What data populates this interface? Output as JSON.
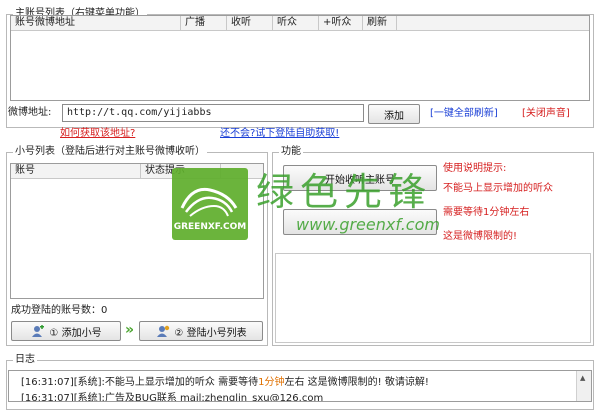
{
  "main_group": {
    "title": "主账号列表（右键菜单功能）",
    "columns": [
      "账号微博地址",
      "广播",
      "收听",
      "听众",
      "+听众",
      "刷新"
    ]
  },
  "weibo_address": {
    "label": "微博地址:",
    "value": "http://t.qq.com/yijiabbs",
    "add_button": "添加",
    "refresh_all_link": "[一键全部刷新]",
    "mute_link": "[关闭声音]",
    "how_to_link": "如何获取该地址?",
    "auto_get_link": "还不会?试下登陆自助获取!"
  },
  "sub_group": {
    "title": "小号列表（登陆后进行对主账号微博收听）",
    "columns": [
      "账号",
      "状态提示"
    ],
    "success_label": "成功登陆的账号数：",
    "success_count": "0",
    "add_sub_button": "① 添加小号",
    "login_list_button": "② 登陆小号列表",
    "arrow": "»"
  },
  "func_group": {
    "title": "功能",
    "start_button": "开始收听主账号",
    "usage_title": "使用说明提示:",
    "usage_lines": [
      "不能马上显示增加的听众",
      "需要等待1分钟左右",
      "这是微博限制的!"
    ]
  },
  "watermark": {
    "cn": "绿色先锋",
    "url": "www.greenxf.com",
    "logo_text": "GREENXF.COM"
  },
  "log_group": {
    "title": "日志",
    "line1_prefix": "[16:31:07][系统]:不能马上显示增加的听众 需要等待",
    "line1_highlight": "1分钟",
    "line1_suffix": "左右 这是微博限制的! 敬请谅解!",
    "line2": "[16:31:07][系统]:广告及BUG联系 mail:zhenglin_sxu@126.com"
  },
  "colors": {
    "link_blue": "#1a3fd6",
    "link_red": "#d62020",
    "usage_red": "#d62020",
    "highlight_orange": "#e07000",
    "watermark_green": "#4aa52f"
  }
}
